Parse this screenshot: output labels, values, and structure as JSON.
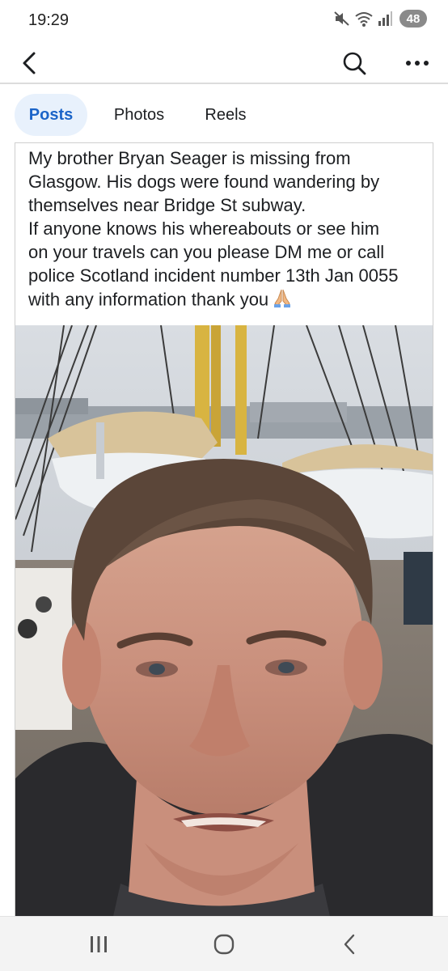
{
  "status_bar": {
    "time": "19:29",
    "battery": "48",
    "icons": [
      "mute-icon",
      "wifi-icon",
      "signal-icon"
    ]
  },
  "header": {
    "icons": [
      "back-arrow-icon",
      "search-icon",
      "more-icon"
    ]
  },
  "tabs": [
    {
      "label": "Posts",
      "active": true
    },
    {
      "label": "Photos",
      "active": false
    },
    {
      "label": "Reels",
      "active": false
    }
  ],
  "post": {
    "lines": [
      "My brother Bryan Seager is missing from",
      "Glasgow. His dogs were found wandering by",
      "themselves near Bridge St subway.",
      "If anyone knows his whereabouts or see him",
      "on your travels can you please DM me or call",
      "police Scotland incident number 13th Jan 0055",
      "with any information thank you"
    ],
    "emoji": "folded-hands-icon"
  },
  "nav_bar": {
    "icons": [
      "recent-apps-icon",
      "home-icon",
      "back-icon"
    ]
  },
  "colors": {
    "accent": "#1b64c8",
    "tab_active_bg": "#e8f1fc"
  }
}
